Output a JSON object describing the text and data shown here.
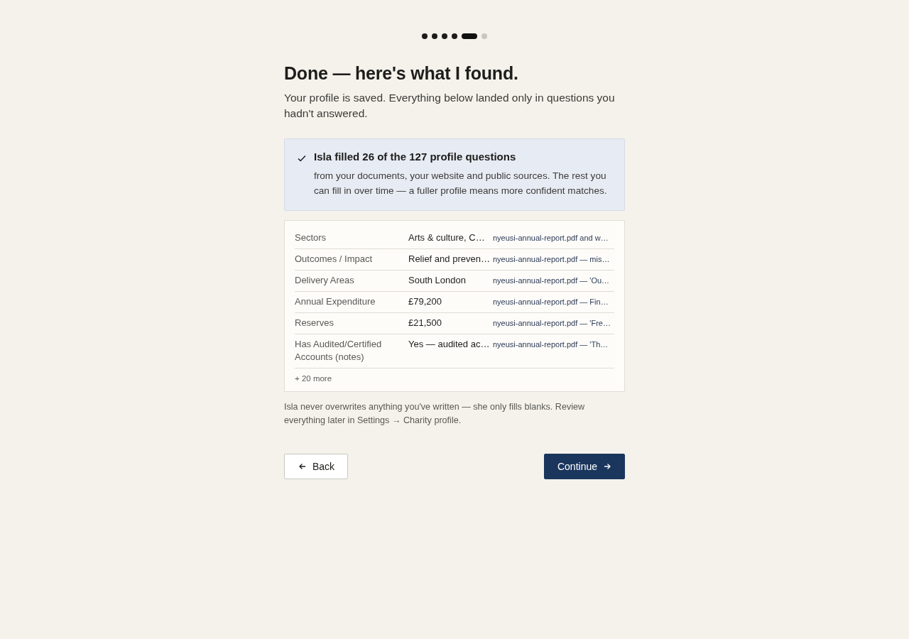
{
  "steps": [
    {
      "done": true,
      "selected": false
    },
    {
      "done": true,
      "selected": false
    },
    {
      "done": true,
      "selected": false
    },
    {
      "done": true,
      "selected": false
    },
    {
      "done": true,
      "selected": true
    },
    {
      "done": false,
      "selected": false
    }
  ],
  "title": "Done — here's what I found.",
  "subtitle": "Your profile is saved. Everything below landed only in questions you hadn't answered.",
  "summary": {
    "heading": "Isla filled 26 of the 127 profile questions",
    "text": "from your documents, your website and public sources. The rest you can fill in over time — a fuller profile means more confident matches."
  },
  "fields": [
    {
      "label": "Sectors",
      "value": "Arts & culture, C…",
      "source": "nyeusi-annual-report.pdf and w…"
    },
    {
      "label": "Outcomes / Impact",
      "value": "Relief and preven…",
      "source": "nyeusi-annual-report.pdf — mis…"
    },
    {
      "label": "Delivery Areas",
      "value": "South London",
      "source": "nyeusi-annual-report.pdf — 'Ou…"
    },
    {
      "label": "Annual Expenditure",
      "value": "£79,200",
      "source": "nyeusi-annual-report.pdf — Fin…"
    },
    {
      "label": "Reserves",
      "value": "£21,500",
      "source": "nyeusi-annual-report.pdf — 'Fre…"
    },
    {
      "label": "Has Audited/Certified Accounts (notes)",
      "value": "Yes — audited ac…",
      "source": "nyeusi-annual-report.pdf — 'Th…"
    }
  ],
  "more": "+ 20 more",
  "note": "Isla never overwrites anything you've written — she only fills blanks. Review everything later in Settings → Charity profile.",
  "buttons": {
    "back": "Back",
    "continue": "Continue"
  }
}
